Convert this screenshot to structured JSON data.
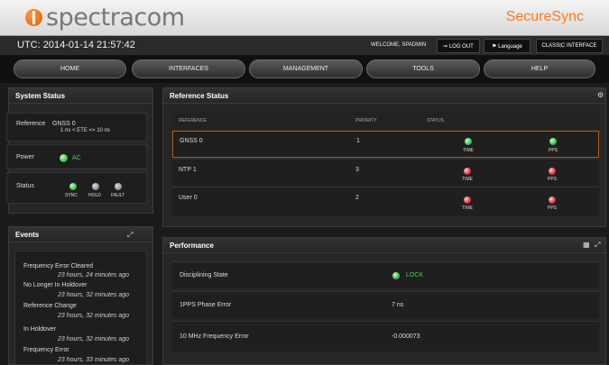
{
  "header": {
    "logo_text": "spectracom",
    "product": "SecureSync"
  },
  "infobar": {
    "utc": "UTC: 2014-01-14 21:57:42",
    "welcome": "WELCOME, SPADMIN",
    "logout": "⇒ LOG OUT",
    "language": "⚑ Language",
    "classic": "CLASSIC INTERFACE"
  },
  "nav": {
    "items": [
      "HOME",
      "INTERFACES",
      "MANAGEMENT",
      "TOOLS",
      "HELP"
    ]
  },
  "system_status": {
    "title": "System Status",
    "reference_label": "Reference",
    "reference_value": "GNSS 0",
    "reference_sub": "1 ns < ETE <= 10 ns",
    "power_label": "Power",
    "power_value": "AC",
    "status_label": "Status",
    "indicators": [
      "SYNC",
      "HOLD",
      "FAULT"
    ]
  },
  "reference_status": {
    "title": "Reference Status",
    "columns": [
      "REFERENCE",
      "PRIORITY",
      "STATUS"
    ],
    "rows": [
      {
        "name": "GNSS 0",
        "priority": "1",
        "time": "TIME",
        "pps": "PPS",
        "time_color": "#3cc24a",
        "pps_color": "#3cc24a"
      },
      {
        "name": "NTP 1",
        "priority": "3",
        "time": "TIME",
        "pps": "PPS",
        "time_color": "#e0303c",
        "pps_color": "#e0303c"
      },
      {
        "name": "User 0",
        "priority": "2",
        "time": "TIME",
        "pps": "PPS",
        "time_color": "#e0303c",
        "pps_color": "#e0303c"
      }
    ]
  },
  "events": {
    "title": "Events",
    "items": [
      {
        "title": "Frequency Error Cleared",
        "time": "23 hours, 24 minutes ago"
      },
      {
        "title": "No Longer In Holdover",
        "time": "23 hours, 32 minutes ago"
      },
      {
        "title": "Reference Change",
        "time": "23 hours, 32 minutes ago"
      },
      {
        "title": "In Holdover",
        "time": "23 hours, 32 minutes ago"
      },
      {
        "title": "Frequency Error",
        "time": "23 hours, 33 minutes ago"
      }
    ]
  },
  "performance": {
    "title": "Performance",
    "rows": [
      {
        "label": "Disciplining State",
        "value": "LOCK"
      },
      {
        "label": "1PPS Phase Error",
        "value": "7 ns"
      },
      {
        "label": "10 MHz Frequency Error",
        "value": "-0.000073"
      }
    ]
  },
  "colors": {
    "accent": "#ff7a1a",
    "led_ok": "#3cc24a",
    "led_bad": "#e0303c",
    "led_off": "#999999"
  }
}
